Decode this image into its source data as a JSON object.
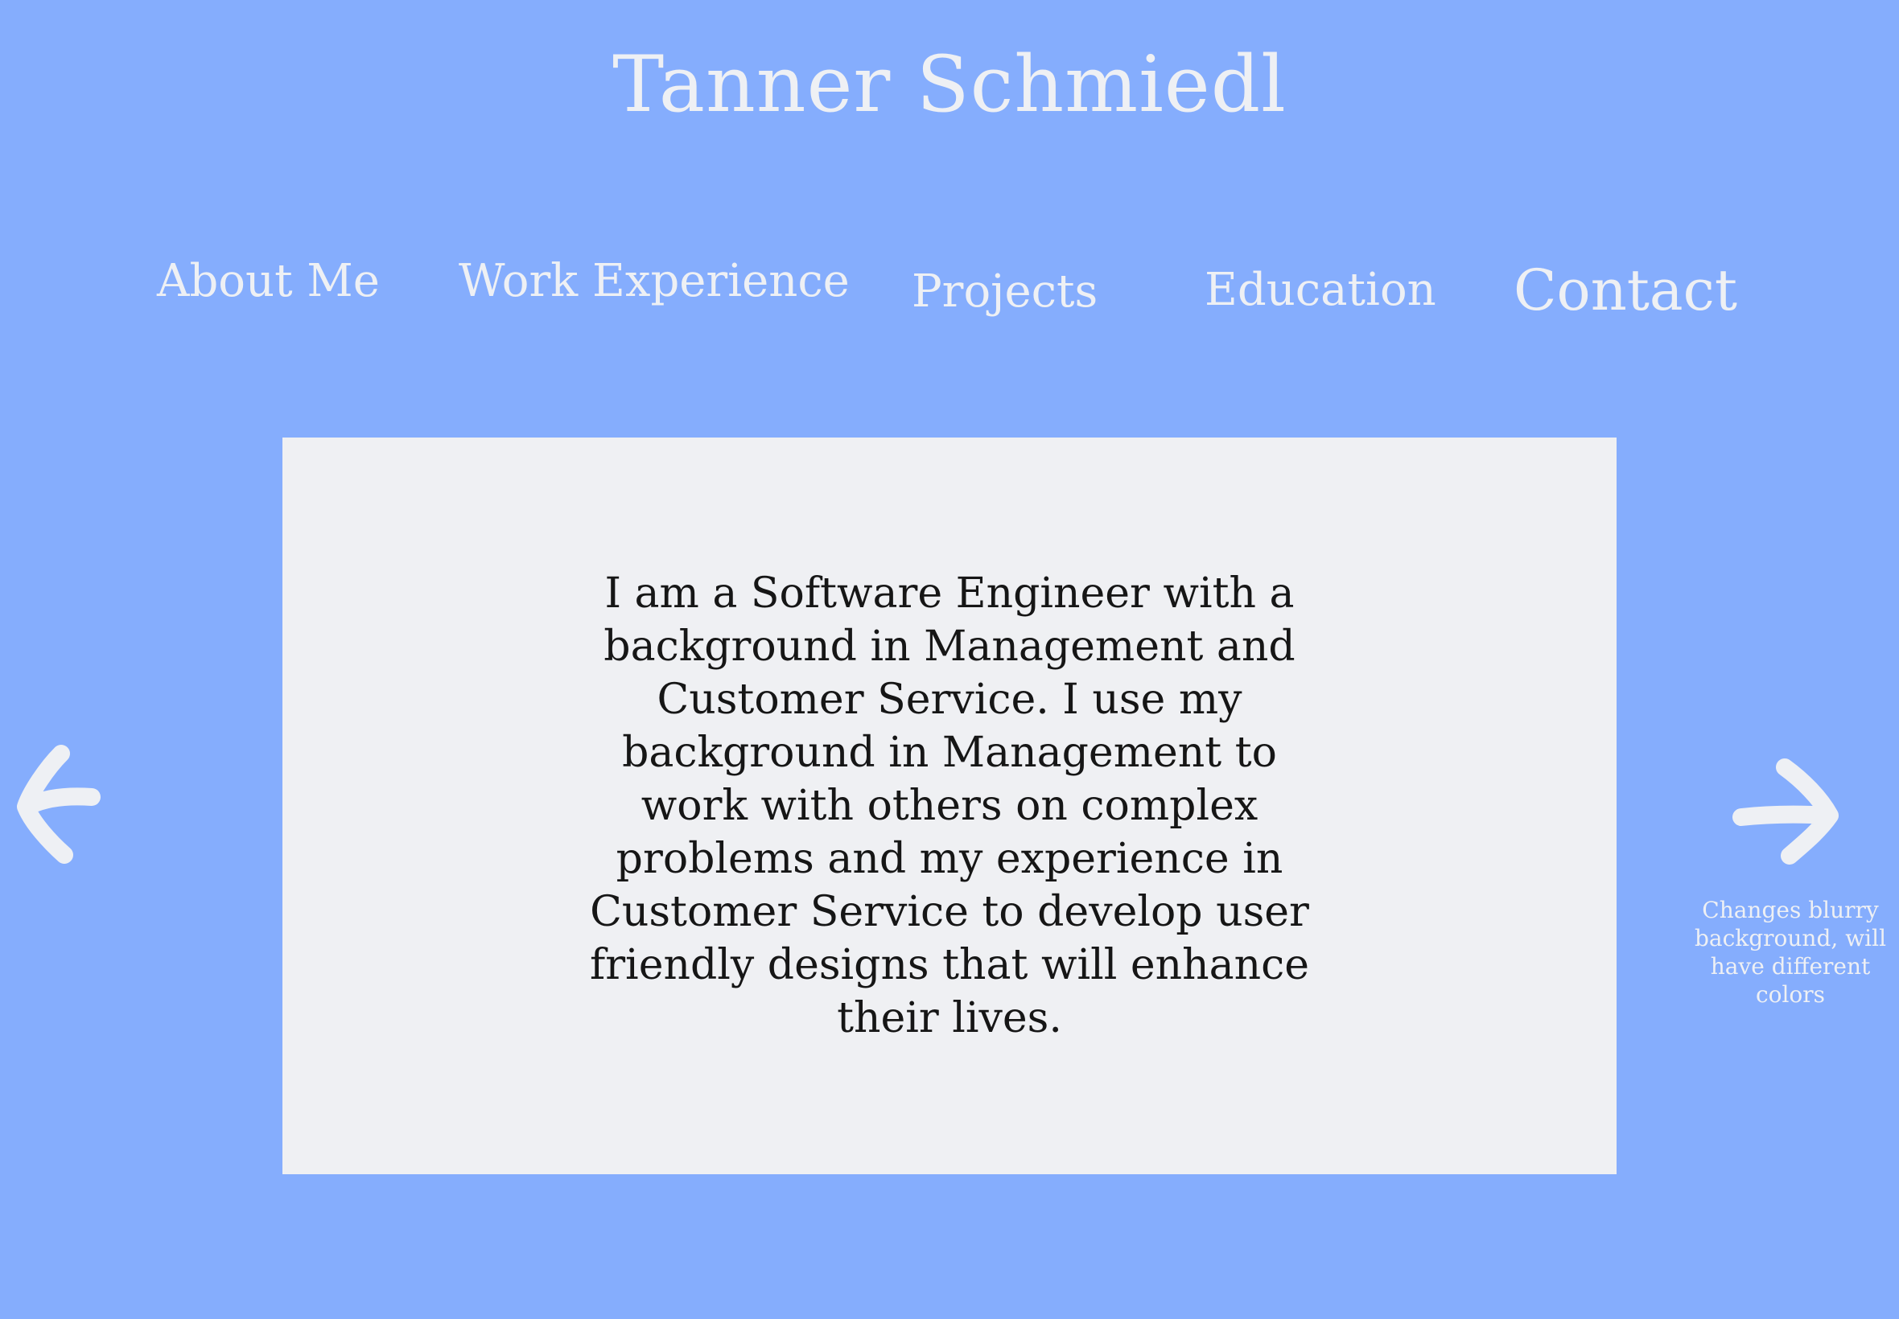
{
  "header": {
    "title": "Tanner Schmiedl"
  },
  "nav": {
    "items": [
      {
        "label": "About Me"
      },
      {
        "label": "Work Experience"
      },
      {
        "label": "Projects"
      },
      {
        "label": "Education"
      },
      {
        "label": "Contact"
      }
    ]
  },
  "main": {
    "bio": "I am a Software Engineer with a background in Management and Customer Service. I use my background in Management to work with others on complex problems and my experience in Customer Service to develop user friendly designs that will enhance their lives."
  },
  "carousel": {
    "prev_icon": "arrow-left-icon",
    "next_icon": "arrow-right-icon",
    "note": "Changes blurry background, will have different colors"
  },
  "colors": {
    "background": "#85adfd",
    "card": "#eff0f3",
    "text_light": "#eef0f4",
    "text_dark": "#161616"
  }
}
